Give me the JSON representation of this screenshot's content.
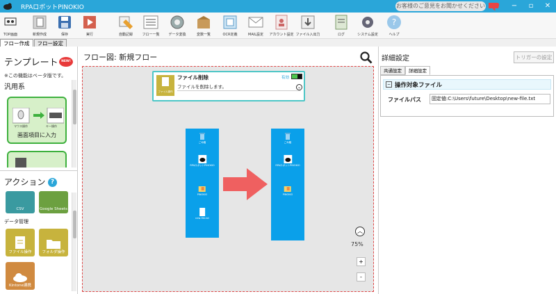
{
  "window": {
    "title": "RPAロボットPINOKIO",
    "feedback": "お客様のご意見をお聞かせください",
    "minimize": "−",
    "maximize": "▫",
    "close": "✕"
  },
  "ribbon": {
    "items": [
      {
        "label": "TOP画面",
        "icon": "robot-logo-icon"
      },
      {
        "label": "新規作成",
        "icon": "new-file-icon"
      },
      {
        "label": "保存",
        "icon": "save-icon"
      },
      {
        "label": "実行",
        "icon": "run-icon"
      },
      {
        "label": "自動記録",
        "icon": "record-icon"
      },
      {
        "label": "フロー一覧",
        "icon": "flow-list-icon"
      },
      {
        "label": "データ変換",
        "icon": "data-convert-icon"
      },
      {
        "label": "変数一覧",
        "icon": "variable-list-icon"
      },
      {
        "label": "OCR定義",
        "icon": "ocr-icon"
      },
      {
        "label": "MAIL設定",
        "icon": "mail-icon"
      },
      {
        "label": "アカウント設定",
        "icon": "account-icon"
      },
      {
        "label": "ファイル入出力",
        "icon": "file-io-icon"
      },
      {
        "label": "ログ",
        "icon": "log-icon"
      },
      {
        "label": "システム設定",
        "icon": "system-settings-icon"
      },
      {
        "label": "ヘルプ",
        "icon": "help-icon"
      }
    ]
  },
  "tabs": [
    "フロー作成",
    "フロー設定"
  ],
  "left": {
    "template_title": "テンプレート",
    "new_badge": "NEW!",
    "beta_note": "※この機能はベータ版です。",
    "category": "汎用系",
    "template_card": {
      "caption": "画面項目に入力",
      "mouse_label": "マウス操作",
      "key_label": "キー操作"
    },
    "action_title": "アクション",
    "help": "?",
    "tiles_top": [
      {
        "label": "CSV",
        "color": "#3a9aa0"
      },
      {
        "label": "Google Sheets",
        "color": "#6ca040"
      }
    ],
    "data_category": "データ管理",
    "tiles": [
      {
        "label": "ファイル操作",
        "color": "#c7b33d"
      },
      {
        "label": "フォルダ操作",
        "color": "#c7b33d"
      },
      {
        "label": "Kintone連携",
        "color": "#d08a40"
      }
    ]
  },
  "center": {
    "title": "フロー図:  新規フロー",
    "action_card": {
      "name": "ファイル削除",
      "icon_label": "ファイル操作",
      "valid_label": "有効",
      "description": "ファイルを削除します。"
    },
    "desktop_before": [
      "ごみ箱",
      "RPAロボットPINOKIO",
      "PINOKIO",
      "new-file.txt"
    ],
    "desktop_after": [
      "ごみ箱",
      "RPAロボットPINOKIO",
      "PINOKIO"
    ],
    "zoom": "75%",
    "zoom_in": "+",
    "zoom_out": "-",
    "scroll_up": "︿"
  },
  "right": {
    "title": "詳細設定",
    "trigger_button": "トリガーの設定",
    "tabs": [
      "共通設定",
      "詳細設定"
    ],
    "section": "操作対象ファイル",
    "collapse": "−",
    "field_label": "ファイルパス",
    "field_value": "固定値:C:\\Users\\future\\Desktop\\new-file.txt"
  },
  "colors": {
    "accent": "#2aa6d9",
    "desktop": "#0aa0ea",
    "arrow": "#ef6060",
    "template_green": "#3db03d"
  }
}
